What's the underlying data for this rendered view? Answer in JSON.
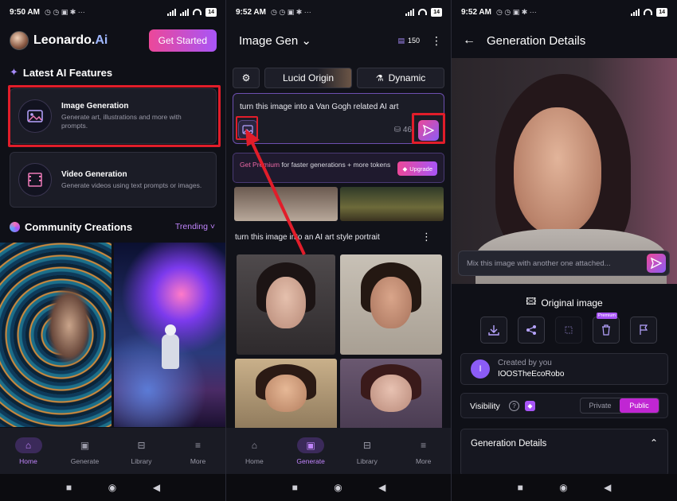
{
  "status": [
    {
      "time": "9:50 AM",
      "battery": "14"
    },
    {
      "time": "9:52 AM",
      "battery": "14"
    },
    {
      "time": "9:52 AM",
      "battery": "14"
    }
  ],
  "home": {
    "brand": "Leonardo.",
    "brand_ai": "Ai",
    "get_started": "Get Started",
    "latest_title": "Latest AI Features",
    "features": [
      {
        "title": "Image Generation",
        "desc": "Generate art, illustrations and more with prompts."
      },
      {
        "title": "Video Generation",
        "desc": "Generate videos using text prompts or images."
      }
    ],
    "community_title": "Community Creations",
    "trending": "Trending"
  },
  "nav": [
    {
      "label": "Home",
      "icon": "home-icon"
    },
    {
      "label": "Generate",
      "icon": "image-icon"
    },
    {
      "label": "Library",
      "icon": "library-icon"
    },
    {
      "label": "More",
      "icon": "menu-icon"
    }
  ],
  "generate": {
    "title": "Image Gen",
    "credits": "150",
    "model": "Lucid Origin",
    "style": "Dynamic",
    "prompt": "turn this image into a Van Gogh related AI art",
    "count": "46",
    "premium_highlight": "Get Premium",
    "premium_text": " for faster generations + more tokens",
    "upgrade": "Upgrade",
    "caption": "turn this image into an AI art style portrait"
  },
  "details": {
    "title": "Generation Details",
    "mix_placeholder": "Mix this image with another one attached...",
    "original": "Original image",
    "premium_tag": "Premium",
    "created_by": "Created by you",
    "creator_initial": "I",
    "creator_name": "IOOSTheEcoRobo",
    "visibility": "Visibility",
    "private": "Private",
    "public": "Public",
    "section": "Generation Details"
  },
  "colors": {
    "accent": "#a855f7",
    "brand_pink": "#ec4899",
    "highlight": "#e11d2a"
  }
}
